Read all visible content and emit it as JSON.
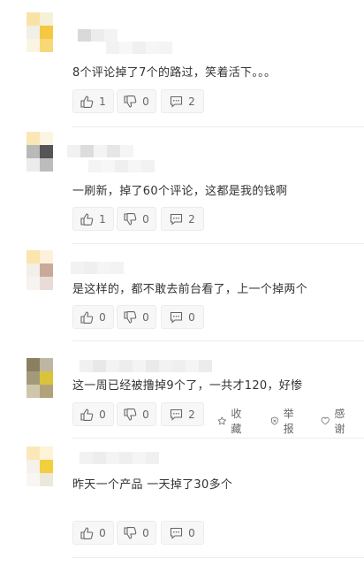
{
  "comments": [
    {
      "text": "8个评论掉了7个的路过，笑着活下。。。",
      "like": "1",
      "dislike": "0",
      "reply": "2"
    },
    {
      "text": "一刷新，掉了60个评论，这都是我的钱啊",
      "like": "1",
      "dislike": "0",
      "reply": "2"
    },
    {
      "text": "是这样的，都不敢去前台看了，上一个掉两个",
      "like": "0",
      "dislike": "0",
      "reply": "0"
    },
    {
      "text": "这一周已经被撸掉9个了，一共才120，好惨",
      "like": "0",
      "dislike": "0",
      "reply": "2",
      "extras": {
        "collect": "收藏",
        "report": "举报",
        "thank": "感谢"
      }
    },
    {
      "text": "昨天一个产品 一天掉了30多个",
      "like": "0",
      "dislike": "0",
      "reply": "0"
    }
  ],
  "icons": {
    "like": "thumb-up-icon",
    "dislike": "thumb-down-icon",
    "reply": "comment-icon",
    "collect": "star-icon",
    "report": "shield-icon",
    "thank": "heart-icon"
  },
  "colors": {
    "text": "#333333",
    "muted": "#666666",
    "button_bg": "#f7f7f7",
    "border": "#ececec",
    "avatar_yellow": "#f5c842",
    "avatar_cream": "#f8e7b3"
  }
}
